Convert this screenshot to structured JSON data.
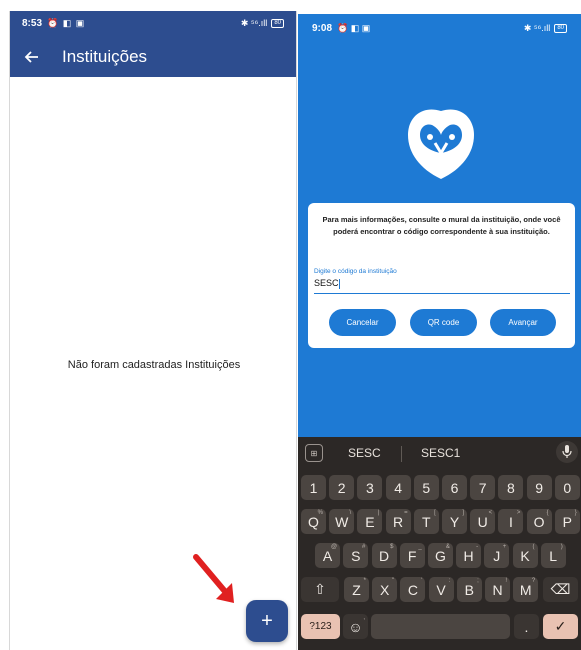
{
  "left_screen": {
    "status": {
      "time": "8:53",
      "icons": "⏰ ◧ ▣",
      "right_icons": "✱ ⁵⁶.ıll",
      "battery": "80"
    },
    "appbar": {
      "back": "←",
      "title": "Instituições"
    },
    "empty_message": "Não foram cadastradas Instituições",
    "fab_label": "+"
  },
  "right_screen": {
    "status": {
      "time": "9:08",
      "icons": "⏰ ◧ ▣",
      "right_icons": "✱ ⁵⁶.ıll",
      "battery": "80"
    },
    "dialog": {
      "message": "Para mais informações, consulte o mural da instituição, onde você poderá encontrar o código correspondente à sua instituição.",
      "field_label": "Digite o código da instituição",
      "field_value": "SESC",
      "buttons": {
        "cancel": "Cancelar",
        "qr": "QR code",
        "next": "Avançar"
      }
    },
    "keyboard": {
      "suggestions": [
        "SESC",
        "SESC1"
      ],
      "row_numbers": [
        "1",
        "2",
        "3",
        "4",
        "5",
        "6",
        "7",
        "8",
        "9",
        "0"
      ],
      "row_q": [
        [
          "Q",
          "%"
        ],
        [
          "W",
          "\\"
        ],
        [
          "E",
          "|"
        ],
        [
          "R",
          "="
        ],
        [
          "T",
          "["
        ],
        [
          "Y",
          "]"
        ],
        [
          "U",
          "<"
        ],
        [
          "I",
          ">"
        ],
        [
          "O",
          "{"
        ],
        [
          "P",
          "}"
        ]
      ],
      "row_a": [
        [
          "A",
          "@"
        ],
        [
          "S",
          "#"
        ],
        [
          "D",
          "$"
        ],
        [
          "F",
          "_"
        ],
        [
          "G",
          "&"
        ],
        [
          "H",
          "-"
        ],
        [
          "J",
          "+"
        ],
        [
          "K",
          "("
        ],
        [
          "L",
          ")"
        ]
      ],
      "row_z": [
        [
          "Z",
          "*"
        ],
        [
          "X",
          "\""
        ],
        [
          "C",
          "'"
        ],
        [
          "V",
          ":"
        ],
        [
          "B",
          ";"
        ],
        [
          "N",
          "!"
        ],
        [
          "M",
          "?"
        ]
      ],
      "sym_key": "?123",
      "emoji_key": "☺",
      "comma": ",",
      "period": ".",
      "enter": "✓",
      "backspace": "⌫",
      "shift": "⇧",
      "grid_icon": "⊞"
    }
  },
  "colors": {
    "left_bar": "#2d4d8f",
    "right_bg": "#1e7ad4",
    "arrow": "#e02020"
  }
}
